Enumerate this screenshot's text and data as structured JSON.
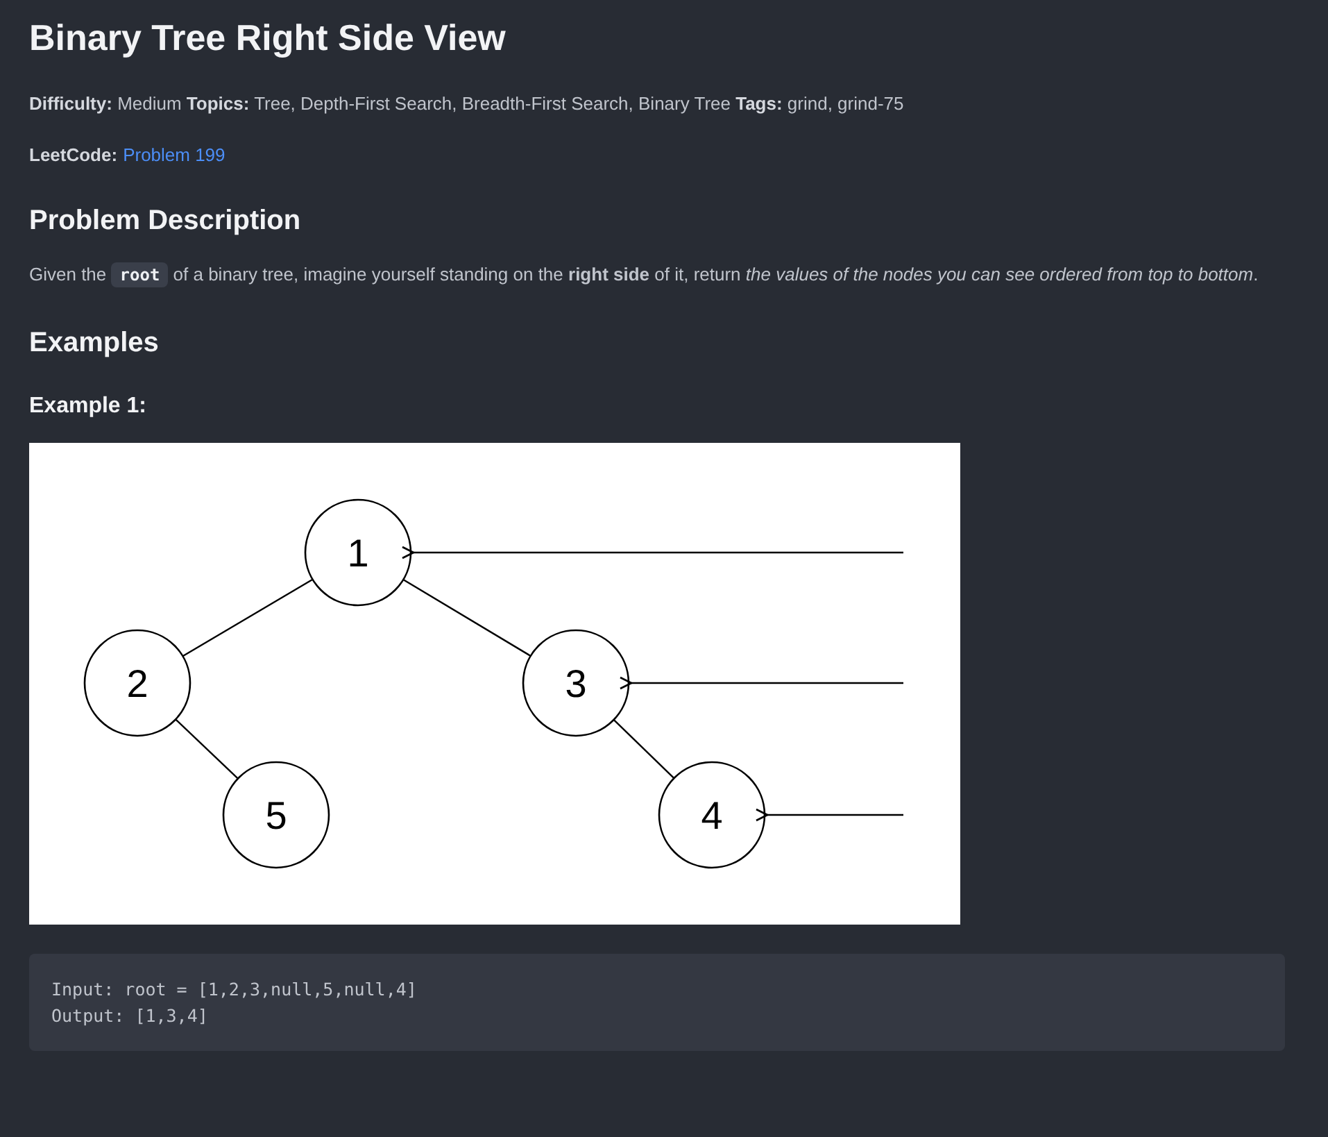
{
  "title": "Binary Tree Right Side View",
  "meta": "**Difficulty:** Medium **Topics:** Tree, Depth-First Search, Breadth-First Search, Binary Tree **Tags:** grind, grind-75",
  "leetcode": {
    "label": "LeetCode:",
    "link": "Problem 199"
  },
  "description": {
    "heading": "Problem Description",
    "segments": [
      {
        "kind": "text",
        "text": "Given the "
      },
      {
        "kind": "code",
        "text": "root"
      },
      {
        "kind": "text",
        "text": " of a binary tree, imagine yourself standing on the "
      },
      {
        "kind": "bold",
        "text": "right side"
      },
      {
        "kind": "text",
        "text": " of it, return "
      },
      {
        "kind": "italic",
        "text": "the values of the nodes you can see ordered from top to bottom"
      },
      {
        "kind": "text",
        "text": "."
      }
    ]
  },
  "examples": {
    "heading": "Examples",
    "items": [
      {
        "title": "Example 1:",
        "tree_nodes": [
          "1",
          "2",
          "3",
          "5",
          "4"
        ],
        "code_lines": [
          "Input: root = [1,2,3,null,5,null,4]",
          "Output: [1,3,4]"
        ]
      }
    ]
  }
}
